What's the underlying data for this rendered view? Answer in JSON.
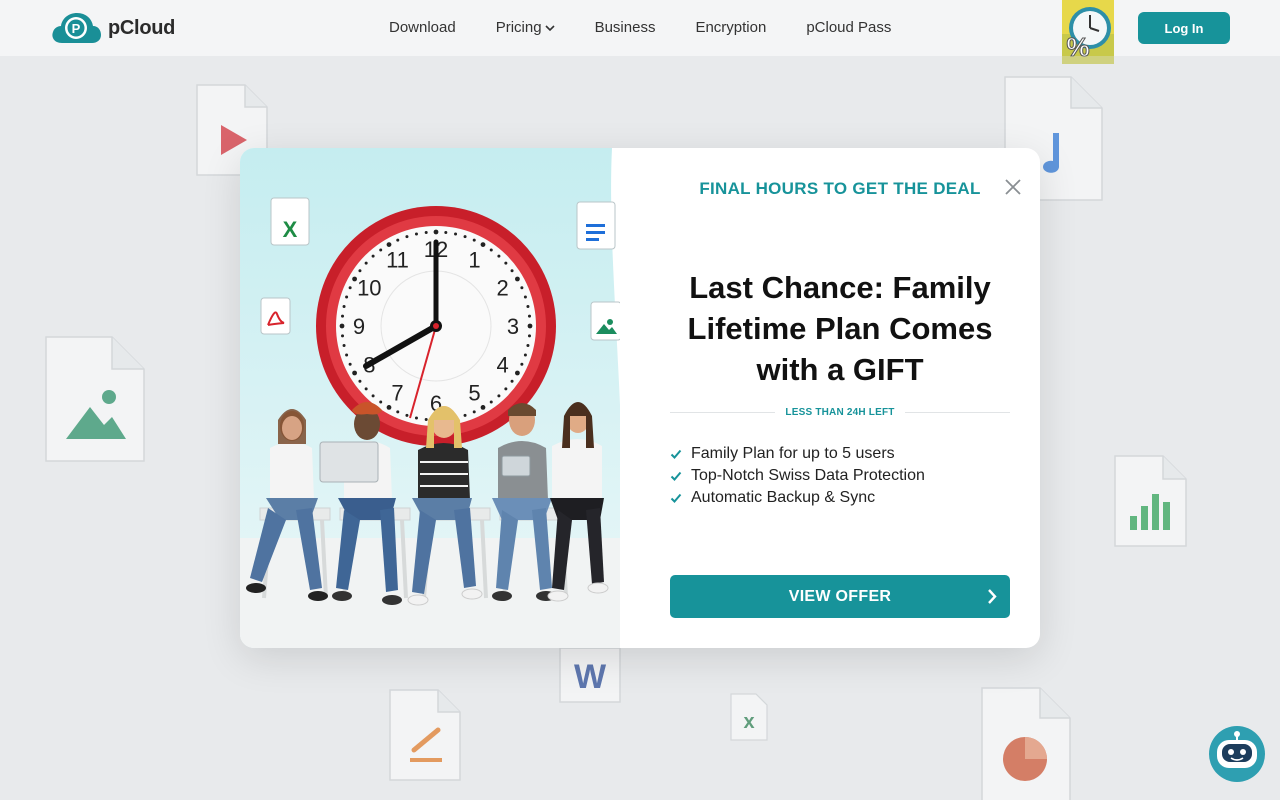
{
  "header": {
    "brand": "pCloud",
    "nav": [
      {
        "label": "Download"
      },
      {
        "label": "Pricing",
        "has_dropdown": true
      },
      {
        "label": "Business"
      },
      {
        "label": "Encryption"
      },
      {
        "label": "pCloud Pass"
      }
    ],
    "login_label": "Log In"
  },
  "modal": {
    "kicker": "FINAL HOURS TO GET THE DEAL",
    "headline": "Last Chance: Family Lifetime Plan Comes with a GIFT",
    "divider_text": "LESS THAN 24H LEFT",
    "features": [
      "Family Plan for up to 5 users",
      "Top-Notch Swiss Data Protection",
      "Automatic Backup & Sync"
    ],
    "cta_label": "VIEW OFFER"
  },
  "clock_numbers": [
    "12",
    "1",
    "2",
    "3",
    "4",
    "5",
    "6",
    "7",
    "8",
    "9",
    "10",
    "11"
  ],
  "colors": {
    "accent": "#17939a",
    "clock_red": "#d42a33"
  }
}
